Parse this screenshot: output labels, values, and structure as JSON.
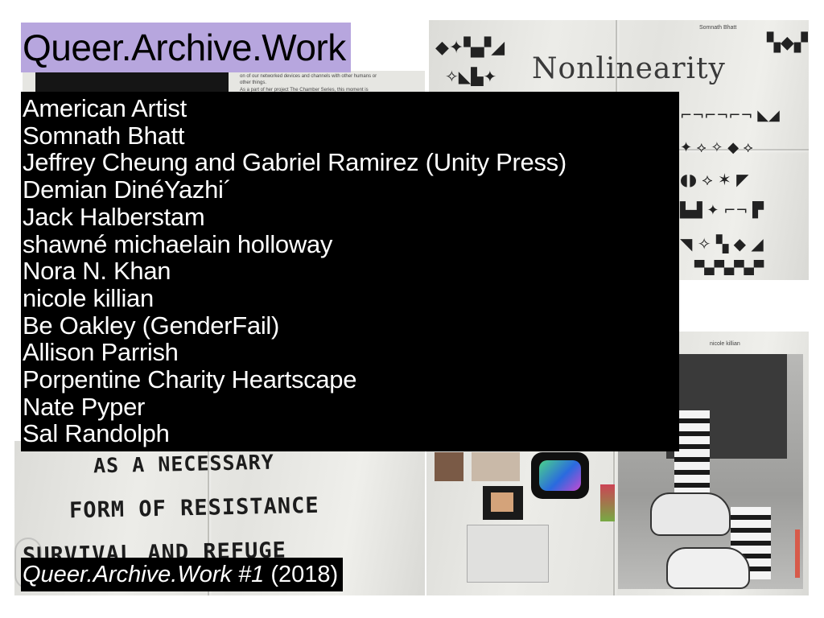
{
  "title": "Queer.Archive.Work",
  "artists": [
    "American Artist",
    "Somnath Bhatt",
    "Jeffrey Cheung and Gabriel Ramirez (Unity Press)",
    "Demian DinéYazhi´",
    "Jack Halberstam",
    "shawné michaelain holloway",
    "Nora N. Khan",
    "nicole killian",
    "Be Oakley (GenderFail)",
    "Allison Parrish",
    "Porpentine Charity Heartscape",
    "Nate Pyper",
    "Sal Randolph"
  ],
  "caption": {
    "italic": "Queer.Archive.Work #1",
    "year": "(2018)"
  },
  "photos": {
    "nonlinearity_title": "Nonlinearity",
    "nonlinearity_byline": "Somnath Bhatt",
    "body_text_1": "on of our networked devices and channels with other humans or",
    "body_text_2": "other things.",
    "body_text_3": "As a part of her project The Chamber Series, this moment is",
    "handwritten_1": "AS A NECESSARY",
    "handwritten_2": "FORM OF RESISTANCE",
    "handwritten_3": "SURVIVAL AND REFUGE",
    "photo_byline": "nicole killian"
  },
  "colors": {
    "title_highlight": "#b7a6de",
    "text_box": "#000000"
  }
}
